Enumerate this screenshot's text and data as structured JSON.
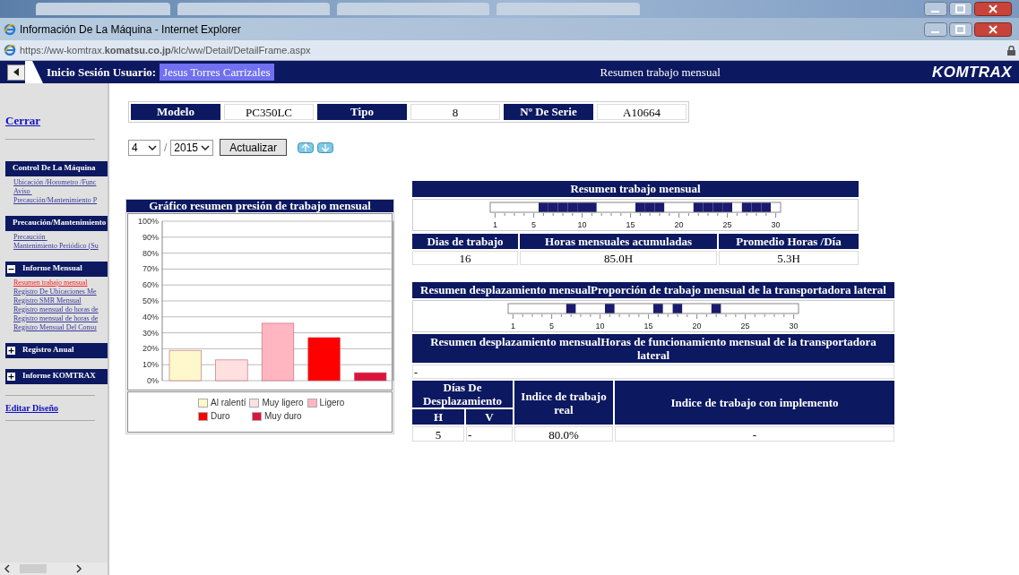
{
  "window": {
    "title": "Información De La Máquina - Internet Explorer"
  },
  "address_bar": {
    "url": "https://ww-komtrax.**komatsu.co.jp**/klc/ww/Detail/DetailFrame.aspx"
  },
  "header": {
    "user_label": "Inicio Sesión Usuario:",
    "user_name": "Jesus Torres Carrizales",
    "page_title": "Resumen trabajo mensual",
    "logo": "KOMTRAX"
  },
  "sidebar": {
    "close_link": "Cerrar",
    "sections": [
      {
        "title": "Control De La Máquina",
        "links": [
          {
            "label": "Ubicación /Horometro /Func",
            "selected": false
          },
          {
            "label": "Aviso ",
            "selected": false
          },
          {
            "label": "Precaución/Mantenimiento P",
            "selected": false
          }
        ]
      },
      {
        "title": "Precaución/Mantenimiento",
        "links": [
          {
            "label": "Precaución ",
            "selected": false
          },
          {
            "label": "Mantenimiento Periódico (Su",
            "selected": false
          }
        ]
      },
      {
        "title": "Informe Mensual",
        "expanded": true,
        "links": [
          {
            "label": "Resumen trabajo mensual",
            "selected": true
          },
          {
            "label": "Registro De Ubicaciones Me",
            "selected": false
          },
          {
            "label": "Registro SMR Mensual",
            "selected": false
          },
          {
            "label": "Registro mensual do horas de",
            "selected": false
          },
          {
            "label": "Registro mensual de horas de",
            "selected": false
          },
          {
            "label": "Registro Mensual Del Consu",
            "selected": false
          }
        ]
      },
      {
        "title": "Registro Anual",
        "expanded": false
      },
      {
        "title": "Informe KOMTRAX",
        "expanded": false
      }
    ],
    "edit_link": "Editar Diseño"
  },
  "machine": [
    {
      "label": "Modelo",
      "value": "PC350LC"
    },
    {
      "label": "Tipo",
      "value": "8"
    },
    {
      "label": "Nº De Serie",
      "value": "A10664"
    }
  ],
  "period": {
    "month": "4",
    "separator": "/",
    "year": "2015",
    "button": "Actualizar"
  },
  "pressure_chart": {
    "title": "Gráfico resumen presión de trabajo mensual",
    "chart_data": {
      "type": "bar",
      "grid": true,
      "ylim": [
        0,
        100
      ],
      "yticks": [
        {
          "value": 0,
          "label": "0%"
        },
        {
          "value": 10,
          "label": "10%"
        },
        {
          "value": 20,
          "label": "20%"
        },
        {
          "value": 30,
          "label": "30%"
        },
        {
          "value": 40,
          "label": "40%"
        },
        {
          "value": 50,
          "label": "50%"
        },
        {
          "value": 60,
          "label": "60%"
        },
        {
          "value": 70,
          "label": "70%"
        },
        {
          "value": 80,
          "label": "80%"
        },
        {
          "value": 90,
          "label": "90%"
        },
        {
          "value": 100,
          "label": "100%"
        }
      ],
      "series": [
        {
          "name": "Al ralentí",
          "color": "#fff8cc",
          "values": [
            19
          ]
        },
        {
          "name": "Muy ligero",
          "color": "#ffe0e0",
          "values": [
            13
          ]
        },
        {
          "name": "Ligero",
          "color": "#ffb6c1",
          "values": [
            36
          ]
        },
        {
          "name": "Duro",
          "color": "#ff0000",
          "values": [
            27
          ]
        },
        {
          "name": "Muy duro",
          "color": "#dc143c",
          "values": [
            5
          ]
        }
      ]
    }
  },
  "work_summary": {
    "title": "Resumen trabajo mensual",
    "days_on": [
      false,
      false,
      false,
      false,
      false,
      true,
      true,
      true,
      true,
      true,
      true,
      false,
      false,
      false,
      false,
      true,
      true,
      true,
      false,
      false,
      false,
      true,
      true,
      true,
      true,
      false,
      true,
      true,
      true,
      false
    ],
    "scale_labels": [
      "1",
      "5",
      "10",
      "15",
      "20",
      "25",
      "30"
    ],
    "columns": [
      "Dias de trabajo",
      "Horas mensuales acumuladas",
      "Promedio Horas /Día"
    ],
    "values": [
      "16",
      "85.0H",
      "5.3H"
    ]
  },
  "travel": {
    "title": "Resumen desplazamiento mensualProporción de trabajo mensual de la transportadora lateral",
    "days_on": [
      false,
      false,
      false,
      false,
      false,
      false,
      true,
      false,
      false,
      false,
      true,
      false,
      false,
      false,
      false,
      true,
      false,
      true,
      false,
      false,
      false,
      true,
      false,
      false,
      false,
      false,
      false,
      false,
      false,
      false
    ],
    "scale_labels": [
      "1",
      "5",
      "10",
      "15",
      "20",
      "25",
      "30"
    ],
    "hours_title": "Resumen desplazamiento mensualHoras de funcionamiento mensual de la transportadora lateral",
    "hours_value": "-",
    "table": {
      "days_header": "Días De Desplazamiento",
      "h_header": "H",
      "v_header": "V",
      "real_header": "Indice de trabajo real",
      "implement_header": "Indice de trabajo con implemento",
      "row": [
        "5",
        "-",
        "80.0%",
        "-"
      ]
    }
  }
}
